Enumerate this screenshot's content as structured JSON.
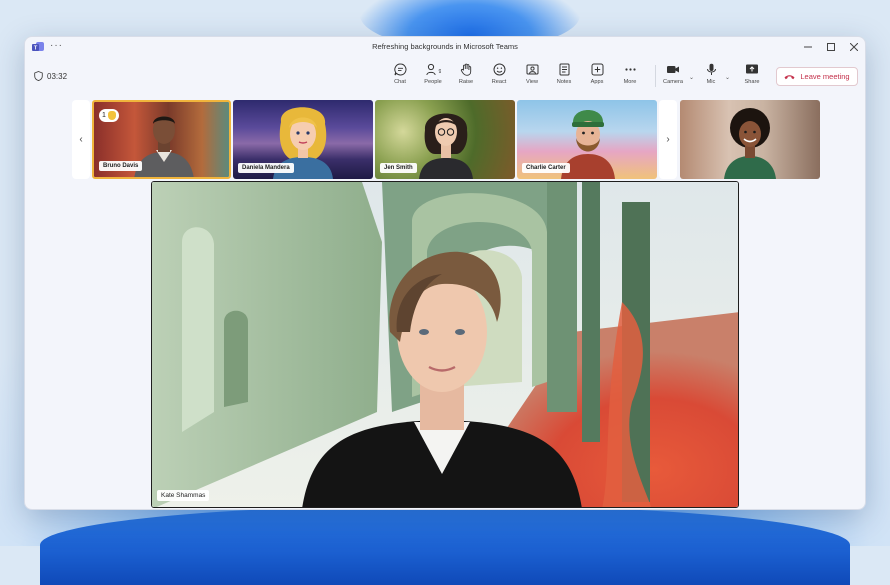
{
  "window": {
    "title": "Refreshing backgrounds in Microsoft Teams"
  },
  "call": {
    "timer": "03:32"
  },
  "toolbar": {
    "chat": "Chat",
    "people": "People",
    "people_count": "9",
    "raise": "Raise",
    "react": "React",
    "view": "View",
    "notes": "Notes",
    "apps": "Apps",
    "more": "More",
    "camera": "Camera",
    "mic": "Mic",
    "share": "Share",
    "leave": "Leave meeting"
  },
  "participants": [
    {
      "name": "Bruno Davis",
      "raised_hand_count": "1",
      "active": true
    },
    {
      "name": "Daniela Mandera"
    },
    {
      "name": "Jen Smith"
    },
    {
      "name": "Charlie Carter"
    },
    {
      "name": ""
    }
  ],
  "main_speaker": {
    "name": "Kate Shammas"
  },
  "colors": {
    "accent": "#5b5fc7",
    "leave": "#c4314b",
    "active_border": "#f0b43c"
  }
}
